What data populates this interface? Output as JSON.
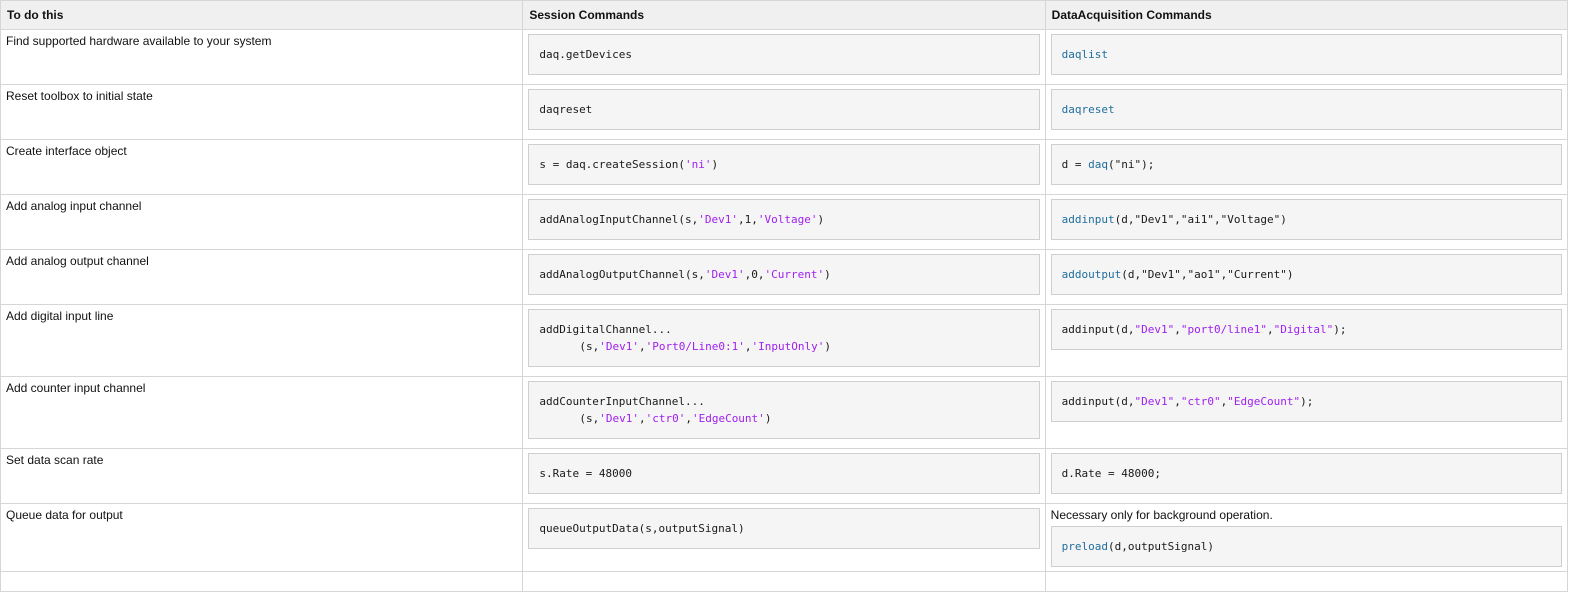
{
  "header": {
    "col1": "To do this",
    "col2": "Session Commands",
    "col3": "DataAcquisition Commands"
  },
  "rows": [
    {
      "task": "Find supported hardware available to your system",
      "session": [
        {
          "t": "daq.getDevices",
          "c": ""
        }
      ],
      "daq": [
        {
          "t": "daqlist",
          "c": "fn"
        }
      ]
    },
    {
      "task": "Reset toolbox to initial state",
      "session": [
        {
          "t": "daqreset",
          "c": ""
        }
      ],
      "daq": [
        {
          "t": "daqreset",
          "c": "fn"
        }
      ]
    },
    {
      "task": "Create interface object",
      "session": [
        {
          "t": "s = daq.createSession(",
          "c": ""
        },
        {
          "t": "'ni'",
          "c": "str"
        },
        {
          "t": ")",
          "c": ""
        }
      ],
      "daq": [
        {
          "t": "d = ",
          "c": ""
        },
        {
          "t": "daq",
          "c": "fn"
        },
        {
          "t": "(\"ni\");",
          "c": ""
        }
      ]
    },
    {
      "task": "Add analog input channel",
      "session": [
        {
          "t": "addAnalogInputChannel(s,",
          "c": ""
        },
        {
          "t": "'Dev1'",
          "c": "str"
        },
        {
          "t": ",1,",
          "c": ""
        },
        {
          "t": "'Voltage'",
          "c": "str"
        },
        {
          "t": ")",
          "c": ""
        }
      ],
      "daq": [
        {
          "t": "addinput",
          "c": "fn"
        },
        {
          "t": "(d,\"Dev1\",\"ai1\",\"Voltage\")",
          "c": ""
        }
      ]
    },
    {
      "task": "Add analog output channel",
      "session": [
        {
          "t": "addAnalogOutputChannel(s,",
          "c": ""
        },
        {
          "t": "'Dev1'",
          "c": "str"
        },
        {
          "t": ",0,",
          "c": ""
        },
        {
          "t": "'Current'",
          "c": "str"
        },
        {
          "t": ")",
          "c": ""
        }
      ],
      "daq": [
        {
          "t": "addoutput",
          "c": "fn"
        },
        {
          "t": "(d,\"Dev1\",\"ao1\",\"Current\")",
          "c": ""
        }
      ]
    },
    {
      "task": "Add digital input line",
      "session": [
        {
          "t": "addDigitalChannel...",
          "c": ""
        }
      ],
      "session2": [
        {
          "t": "(s,",
          "c": ""
        },
        {
          "t": "'Dev1'",
          "c": "str"
        },
        {
          "t": ",",
          "c": ""
        },
        {
          "t": "'Port0/Line0:1'",
          "c": "str"
        },
        {
          "t": ",",
          "c": ""
        },
        {
          "t": "'InputOnly'",
          "c": "str"
        },
        {
          "t": ")",
          "c": ""
        }
      ],
      "daq": [
        {
          "t": "addinput(d,",
          "c": ""
        },
        {
          "t": "\"Dev1\"",
          "c": "str"
        },
        {
          "t": ",",
          "c": ""
        },
        {
          "t": "\"port0/line1\"",
          "c": "str"
        },
        {
          "t": ",",
          "c": ""
        },
        {
          "t": "\"Digital\"",
          "c": "str"
        },
        {
          "t": ");",
          "c": ""
        }
      ]
    },
    {
      "task": "Add counter input channel",
      "session": [
        {
          "t": "addCounterInputChannel...",
          "c": ""
        }
      ],
      "session2": [
        {
          "t": "(s,",
          "c": ""
        },
        {
          "t": "'Dev1'",
          "c": "str"
        },
        {
          "t": ",",
          "c": ""
        },
        {
          "t": "'ctr0'",
          "c": "str"
        },
        {
          "t": ",",
          "c": ""
        },
        {
          "t": "'EdgeCount'",
          "c": "str"
        },
        {
          "t": ")",
          "c": ""
        }
      ],
      "daq": [
        {
          "t": "addinput(d,",
          "c": ""
        },
        {
          "t": "\"Dev1\"",
          "c": "str"
        },
        {
          "t": ",",
          "c": ""
        },
        {
          "t": "\"ctr0\"",
          "c": "str"
        },
        {
          "t": ",",
          "c": ""
        },
        {
          "t": "\"EdgeCount\"",
          "c": "str"
        },
        {
          "t": ");",
          "c": ""
        }
      ]
    },
    {
      "task": "Set data scan rate",
      "session": [
        {
          "t": "s.Rate = 48000",
          "c": ""
        }
      ],
      "daq": [
        {
          "t": "d.Rate = 48000;",
          "c": ""
        }
      ]
    },
    {
      "task": "Queue data for output",
      "session": [
        {
          "t": "queueOutputData(s,outputSignal)",
          "c": ""
        }
      ],
      "daq_note": "Necessary only for background operation.",
      "daq": [
        {
          "t": "preload",
          "c": "fn"
        },
        {
          "t": "(d,outputSignal)",
          "c": ""
        }
      ]
    }
  ]
}
